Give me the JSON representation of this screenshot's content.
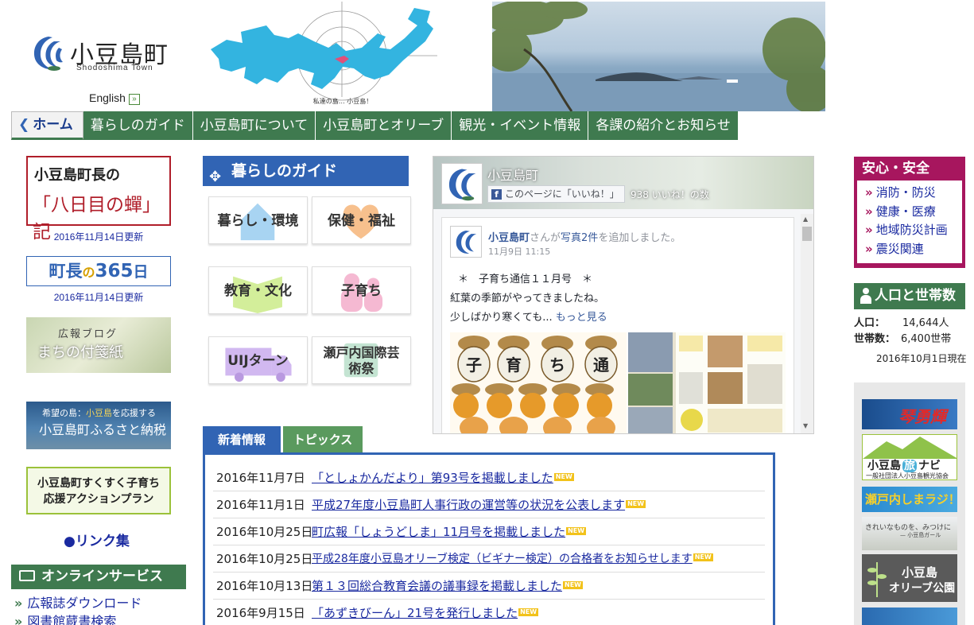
{
  "header": {
    "logo_title": "小豆島町",
    "logo_subtitle": "Shodoshima Town",
    "english_link": "English",
    "map_caption": "私達の島… 小豆島！"
  },
  "nav": {
    "items": [
      "ホーム",
      "暮らしのガイド",
      "小豆島町について",
      "小豆島町とオリーブ",
      "観光・イベント情報",
      "各課の紹介とお知らせ"
    ]
  },
  "left": {
    "mayor_title": "小豆島町長の",
    "mayor_sub": "「八日目の蟬」記",
    "mayor_updated": "2016年11月14日更新",
    "mayor365_a": "町長",
    "mayor365_b": "の",
    "mayor365_c": "365",
    "mayor365_d": "日",
    "mayor365_updated": "2016年11月14日更新",
    "blog_top": "広報ブログ",
    "blog_main": "まちの付箋紙",
    "furusato_top_a": "希望の島：",
    "furusato_top_b": "小豆島",
    "furusato_top_c": "を応援する",
    "furusato_main": "小豆島町ふるさと納税",
    "kosodate_line1": "小豆島町すくすく子育ち",
    "kosodate_line2": "応援アクションプラン",
    "links": "●リンク集",
    "online_header": "オンラインサービス",
    "online_items": [
      "広報誌ダウンロード",
      "図書館蔵書検索"
    ]
  },
  "guide": {
    "header": "暮らしのガイド",
    "buttons": [
      "暮らし・環境",
      "保健・福祉",
      "教育・文化",
      "子育ち",
      "UIJターン",
      "瀬戸内国際芸術祭"
    ]
  },
  "facebook": {
    "page_name": "小豆島町",
    "like_button": "このページに「いいね！」",
    "like_count": "938 いいね！の数",
    "post_author": "小豆島町",
    "post_action_a": "さんが",
    "post_action_b": "写真2件",
    "post_action_c": "を追加しました。",
    "post_date": "11月9日 11:15",
    "post_line1": "＊　子育ち通信１１月号　＊",
    "post_line2": "紅葉の季節がやってきましたね。",
    "post_line3": "少しばかり寒くても...",
    "more_link": "もっと見る",
    "acorn_chars": [
      "子",
      "育",
      "ち",
      "通"
    ]
  },
  "news": {
    "tabs": [
      "新着情報",
      "トピックス"
    ],
    "new_badge": "NEW",
    "items": [
      {
        "date": "2016年11月7日",
        "title": "「としょかんだより」第93号を掲載しました"
      },
      {
        "date": "2016年11月1日",
        "title": "平成27年度小豆島町人事行政の運営等の状況を公表します"
      },
      {
        "date": "2016年10月25日",
        "title": "町広報「しょうどしま」11月号を掲載しました"
      },
      {
        "date": "2016年10月25日",
        "title": "平成28年度小豆島オリーブ検定（ビギナー検定）の合格者をお知らせします"
      },
      {
        "date": "2016年10月13日",
        "title": "第１３回総合教育会議の議事録を掲載しました"
      },
      {
        "date": "2016年9月15日",
        "title": "「あずきびーん」21号を発行しました"
      }
    ]
  },
  "right": {
    "safety_header": "安心・安全",
    "safety_items": [
      "消防・防災",
      "健康・医療",
      "地域防災計画",
      "震災関連"
    ],
    "population_header": "人口と世帯数",
    "population_label": "人口：",
    "population_value": "14,644人",
    "households_label": "世帯数：",
    "households_value": "6,400世帯",
    "population_date": "2016年10月1日現在",
    "banner_kotobuki": "琴勇輝",
    "banner_tabinavi_a": "小豆島",
    "banner_tabinavi_b": "旅",
    "banner_tabinavi_c": "ナビ",
    "banner_tabinavi_sub": "一般社団法人小豆島観光協会",
    "banner_radio": "瀬戸内しまラジ！",
    "banner_kirei": "きれいなものを、みつけに",
    "banner_kirei_sub": "— 小豆島ガール",
    "banner_olive_a": "小豆島",
    "banner_olive_b": "オリーブ公園"
  },
  "colors": {
    "green": "#3f7a4f",
    "blue": "#3164b4",
    "magenta": "#a7165e",
    "link": "#1a2aa0"
  }
}
